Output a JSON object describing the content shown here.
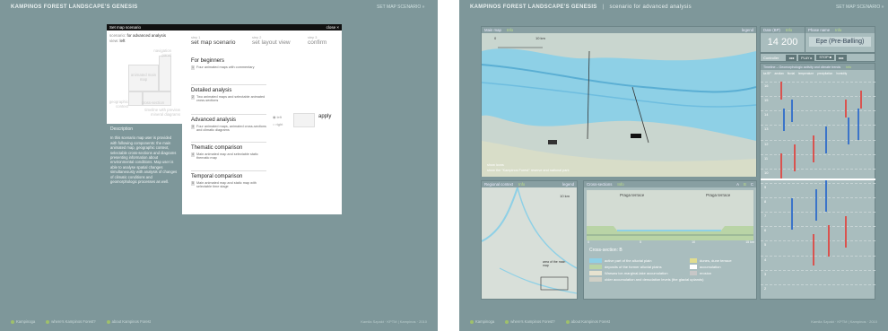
{
  "app": {
    "title": "KAMPINOS FOREST LANDSCAPE'S GENESIS",
    "set_map_scenario": "SET MAP SCENARIO »",
    "separator": "|"
  },
  "footer": {
    "items": [
      "Kampinoga",
      "where's Kampinos Forest?",
      "about Kampinos Forest"
    ],
    "credits": "Kamila Szpakt · KPTM | Kampinos · 2010"
  },
  "dialog": {
    "title": "Set map scenario",
    "close": "close ×",
    "scenario_label": "scenario:",
    "scenario_value": "for advanced analysis",
    "view_label": "view:",
    "view_value": "left",
    "ghost_labels": {
      "navigation": "navigation panel",
      "animated": "animated main map",
      "geographic": "geographic context",
      "cross": "cross-section",
      "timeline": "timeline with preview mineral diagrams"
    },
    "description_title": "Description",
    "description_text": "In this scenario map user is provided with following components: the main animated map, geographic context, selectable cross-sections and diagrams presenting information about environmental conditions. Map user is able to analyse spatial changes simultaneously with analysis of changes of climatic conditions and geomorphologic processes as well.",
    "steps": [
      {
        "num": "step 1",
        "label": "set map scenario"
      },
      {
        "num": "step 2",
        "label": "set layout view"
      },
      {
        "num": "step 3",
        "label": "confirm"
      }
    ],
    "sections": [
      {
        "title": "For beginners",
        "n": "1",
        "text": "Four animated maps with commentary"
      },
      {
        "title": "Detailed analysis",
        "n": "2",
        "text": "Two animated maps and selectable animated cross-sections"
      },
      {
        "title": "Advanced analysis",
        "n": "3",
        "text": "Four animated maps, animated cross-sections and climatic diagrams"
      },
      {
        "title": "Thematic comparison",
        "n": "4",
        "text": "Main animated map and selectable static thematic map"
      },
      {
        "title": "Temporal comparison",
        "n": "5",
        "text": "Main animated map and static map with selectable time stage"
      }
    ],
    "radio_left": "left",
    "radio_right": "right",
    "apply": "apply"
  },
  "right": {
    "subtitle": "scenario for advanced analysis",
    "map_window": {
      "title": "Main map",
      "info": "Info",
      "legend": "legend",
      "scale": "10 km",
      "scale0": "0",
      "toggle1": "show icons",
      "toggle2": "show the \"Kampinos Forest\" reserve and national park"
    },
    "regional_window": {
      "title": "Regional context",
      "info": "Info",
      "legend": "legend",
      "scale": "10 km",
      "note": "area of the main map"
    },
    "xsec_window": {
      "title": "Cross-sections",
      "info": "Info",
      "tabs": [
        "A",
        "B",
        "C"
      ],
      "label_left": "Praga terrace",
      "label_right": "Praga terrace",
      "axis": [
        "0",
        "5",
        "10",
        "15 km"
      ],
      "section_label": "Cross-section: B",
      "legend_left": [
        "active part of the alluvial plain",
        "deposits of the former alluvial plains",
        "Warsaw ice-marginal-lake accumulation",
        "older accumulation and denudation levels (the glacial uplands)"
      ],
      "legend_right": [
        "dunes, dune terrace",
        "accumulation",
        "erosion"
      ]
    },
    "date_window": {
      "title": "Date (BP)",
      "info": "Info",
      "value": "14 200"
    },
    "phase_window": {
      "title": "Phase name",
      "info": "Info",
      "value": "Epe (Pre-Bølling)"
    },
    "controller": {
      "label": "Controller",
      "buttons": [
        "◂◂◂",
        "PLAY ▸",
        "STOP ■",
        "▸▸▸"
      ]
    },
    "timeline": {
      "title": "Timeline – Geomorphologic activity and climate trends",
      "info": "Info",
      "cols": [
        "aeolian",
        "fluvial",
        "temperature",
        "precipitation",
        "humidity"
      ],
      "row_label": "ka BP",
      "ticks": [
        "16",
        "15",
        "14",
        "13",
        "12",
        "11",
        "10",
        "9",
        "8",
        "7",
        "6",
        "5",
        "4",
        "3",
        "2"
      ]
    }
  },
  "colors": {
    "panel": "#7e979a",
    "water": "#8ed0e6",
    "accent_green": "#9fc06a",
    "red": "#d9534f",
    "blue": "#3b74c9"
  }
}
